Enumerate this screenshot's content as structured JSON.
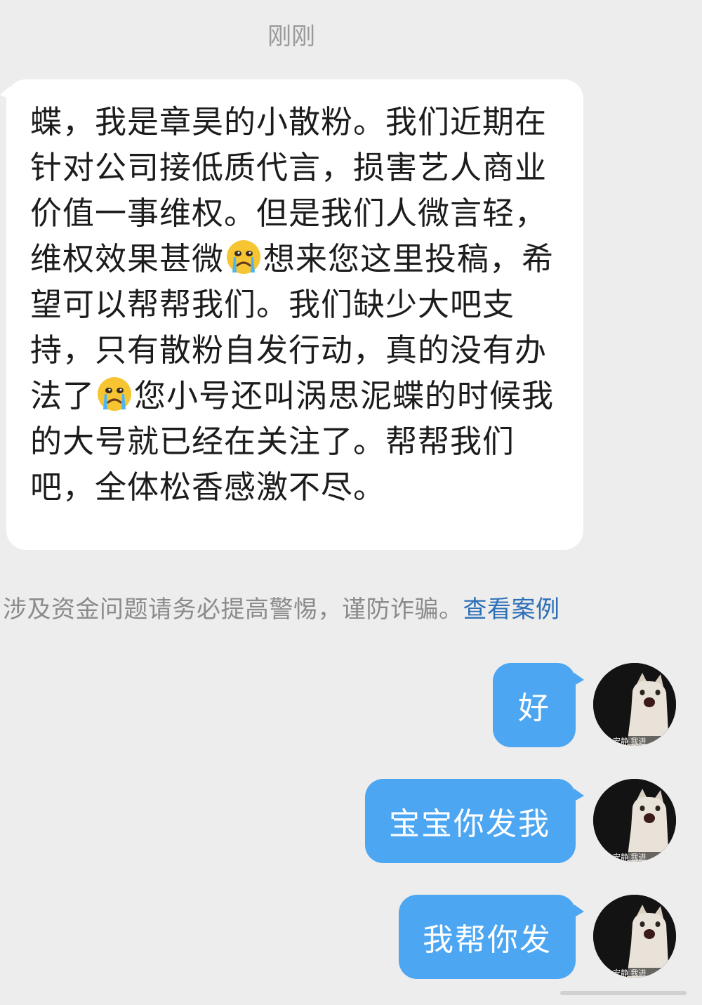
{
  "timestamp": "刚刚",
  "incoming": {
    "part1": "蝶，我是章昊的小散粉。我们近期在针对公司接低质代言，损害艺人商业价值一事维权。但是我们人微言轻，维权效果甚微",
    "emoji1": "crying-face-emoji",
    "part2": "想来您这里投稿，希望可以帮帮我们。我们缺少大吧支持，只有散粉自发行动，真的没有办法了",
    "emoji2": "crying-face-emoji",
    "part3": "您小号还叫涡思泥蝶的时候我的大号就已经在关注了。帮帮我们吧，全体松香感激不尽。"
  },
  "warning": {
    "text": "涉及资金问题请务必提高警惕，谨防诈骗。",
    "link": "查看案例"
  },
  "outgoing": [
    {
      "text": "好"
    },
    {
      "text": "宝宝你发我"
    },
    {
      "text": "我帮你发"
    }
  ],
  "avatar_caption": "安静 我进",
  "colors": {
    "background": "#ededed",
    "incoming_bubble": "#ffffff",
    "outgoing_bubble": "#4da6f2",
    "link": "#2d6fb8"
  }
}
